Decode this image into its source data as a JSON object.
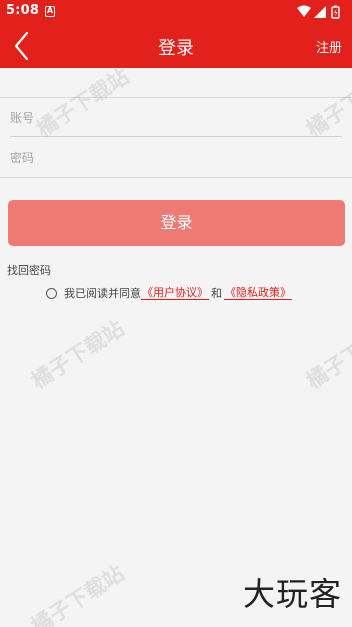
{
  "status_bar": {
    "time": "5:08",
    "notification_glyph": "A",
    "icons": [
      "wifi-icon",
      "signal-icon",
      "battery-icon"
    ]
  },
  "app_bar": {
    "title": "登录",
    "right_action": "注册",
    "background": "#e3211c"
  },
  "form": {
    "account": {
      "placeholder": "账号",
      "value": ""
    },
    "password": {
      "placeholder": "密码",
      "value": ""
    },
    "submit_label": "登录",
    "submit_color": "#ed7a74"
  },
  "links": {
    "find_password": "找回密码"
  },
  "agreement": {
    "prefix": "我已阅读并同意",
    "user_agreement": "《用户协议》",
    "conjunction": "和",
    "privacy_policy": "《隐私政策》"
  },
  "watermark": "橘子下载站",
  "brand": "大玩客"
}
